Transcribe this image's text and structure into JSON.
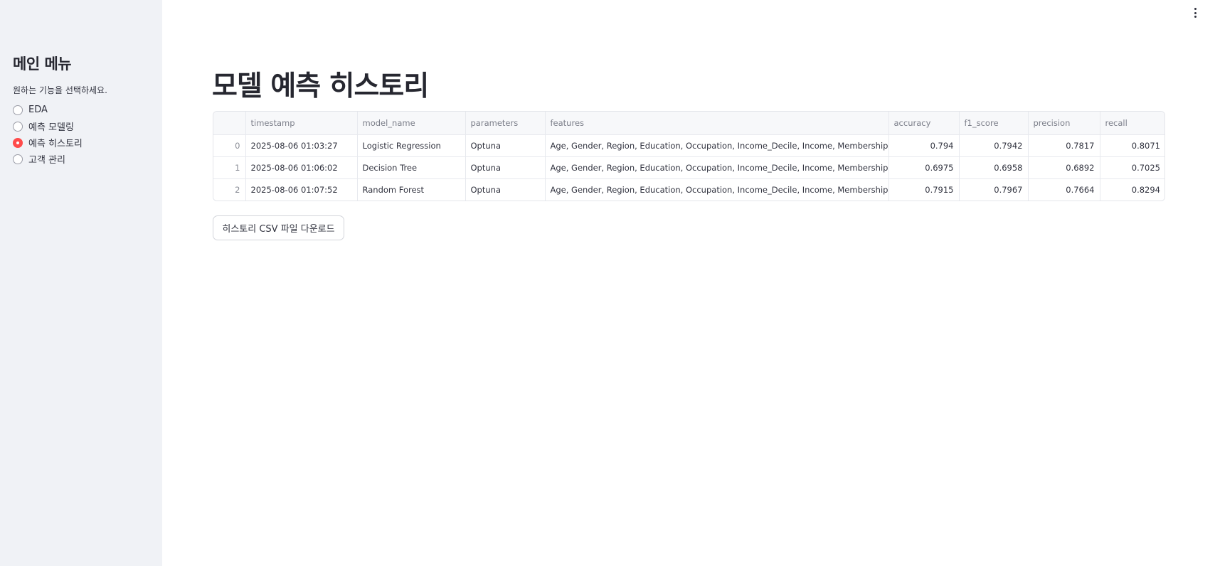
{
  "sidebar": {
    "title": "메인 메뉴",
    "prompt": "원하는 기능을 선택하세요.",
    "options": [
      {
        "label": "EDA",
        "selected": false
      },
      {
        "label": "예측 모델링",
        "selected": false
      },
      {
        "label": "예측 히스토리",
        "selected": true
      },
      {
        "label": "고객 관리",
        "selected": false
      }
    ]
  },
  "main": {
    "title": "모델 예측 히스토리",
    "table": {
      "columns": [
        "",
        "timestamp",
        "model_name",
        "parameters",
        "features",
        "accuracy",
        "f1_score",
        "precision",
        "recall"
      ],
      "rows": [
        [
          "0",
          "2025-08-06 01:03:27",
          "Logistic Regression",
          "Optuna",
          "Age, Gender, Region, Education, Occupation, Income_Decile, Income, MembershipDuration,",
          "0.794",
          "0.7942",
          "0.7817",
          "0.8071"
        ],
        [
          "1",
          "2025-08-06 01:06:02",
          "Decision Tree",
          "Optuna",
          "Age, Gender, Region, Education, Occupation, Income_Decile, Income, MembershipDuration,",
          "0.6975",
          "0.6958",
          "0.6892",
          "0.7025"
        ],
        [
          "2",
          "2025-08-06 01:07:52",
          "Random Forest",
          "Optuna",
          "Age, Gender, Region, Education, Occupation, Income_Decile, Income, MembershipDuration,",
          "0.7915",
          "0.7967",
          "0.7664",
          "0.8294"
        ]
      ]
    },
    "download_button": "히스토리 CSV 파일 다운로드"
  },
  "colors": {
    "sidebar_bg": "#f0f2f6",
    "accent": "#ff4b4b",
    "text": "#31333f"
  },
  "icons": {
    "menu": "more-vert-icon"
  }
}
